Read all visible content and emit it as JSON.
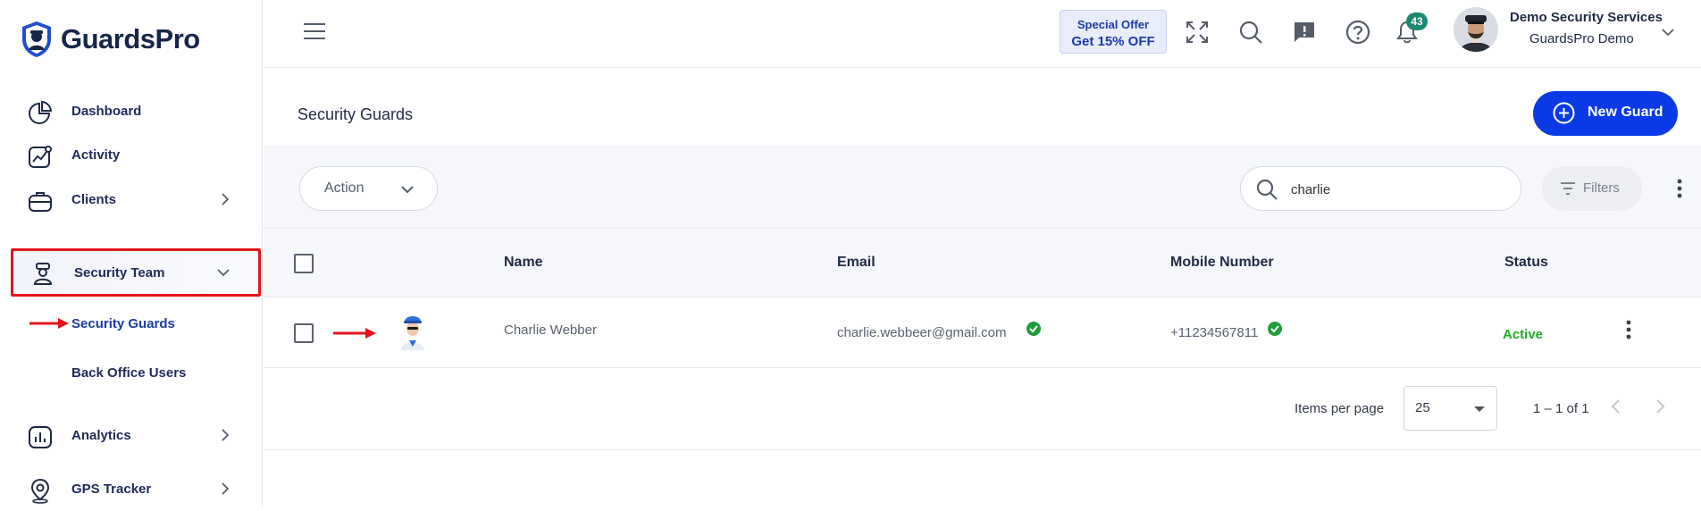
{
  "app": {
    "name": "GuardsPro"
  },
  "sidebar": {
    "items": [
      {
        "label": "Dashboard",
        "icon": "pie-chart-icon"
      },
      {
        "label": "Activity",
        "icon": "activity-chart-icon"
      },
      {
        "label": "Clients",
        "icon": "briefcase-icon"
      },
      {
        "label": "Security Team",
        "icon": "guard-icon"
      },
      {
        "label": "Analytics",
        "icon": "bar-chart-icon"
      },
      {
        "label": "GPS Tracker",
        "icon": "map-pin-icon"
      }
    ],
    "subitems": [
      {
        "label": "Security Guards",
        "active": true
      },
      {
        "label": "Back Office Users",
        "active": false
      }
    ]
  },
  "topbar": {
    "offer_line1": "Special Offer",
    "offer_line2": "Get 15% OFF",
    "notification_count": "43",
    "user_name": "Demo Security Services",
    "user_org": "GuardsPro Demo"
  },
  "page": {
    "title": "Security Guards",
    "new_button": "New Guard"
  },
  "toolbar": {
    "action_label": "Action",
    "search_value": "charlie",
    "filters_label": "Filters"
  },
  "table": {
    "columns": [
      "Name",
      "Email",
      "Mobile Number",
      "Status"
    ],
    "rows": [
      {
        "name": "Charlie Webber",
        "email": "charlie.webbeer@gmail.com",
        "mobile": "+11234567811",
        "status": "Active"
      }
    ]
  },
  "pagination": {
    "items_per_page_label": "Items per page",
    "items_per_page": "25",
    "range": "1 – 1 of 1"
  },
  "colors": {
    "primary": "#0a3ae6",
    "active_status": "#1faa2b",
    "highlight_border": "#e3151b",
    "verified": "#1f9d3a",
    "badge": "#1b8a73"
  }
}
